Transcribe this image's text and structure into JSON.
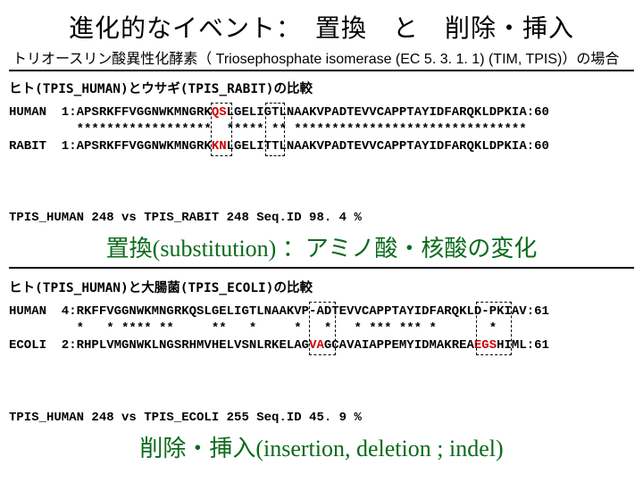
{
  "title": "進化的なイベント：　置換　と　削除・挿入",
  "subtitle": "トリオースリン酸異性化酵素（ Triosephosphate isomerase (EC  5. 3. 1. 1)  (TIM, TPIS)）の場合",
  "section1": {
    "label": "ヒト(TPIS_HUMAN)とウサギ(TPIS_RABIT)の比較",
    "human_a": "HUMAN  1:APSRKFFVGGNWKMNGRK",
    "human_r": "QS",
    "human_b": "LGELI",
    "human_c": "GT",
    "human_d": "LNAAKVPADTEVVCAPPTAYIDFARQKLDPKIA:60",
    "stars": "         ******************  ***** ** *******************************",
    "rabit_a": "RABIT  1:APSRKFFVGGNWKMNGRK",
    "rabit_r": "KN",
    "rabit_b": "LGELI",
    "rabit_c": "TT",
    "rabit_d": "LNAAKVPADTEVVCAPPTAYIDFARQKLDPKIA:60",
    "summary": "TPIS_HUMAN 248 vs TPIS_RABIT 248 Seq.ID 98. 4 %",
    "concept": "置換(substitution) ：アミノ酸・核酸の変化"
  },
  "section2": {
    "label": "ヒト(TPIS_HUMAN)と大腸菌(TPIS_ECOLI)の比較",
    "human": "HUMAN  4:RKFFVGGNWKMNGRKQSLGELIGTLNAAKVP-ADTEVVCAPPTAYIDFARQKLD-PKIAV:61",
    "stars": "         *   * **** **     **   *     *   *   * *** *** *       *",
    "ecoli_a": "ECOLI  2:RHPLVMGNWKLNGSRHMVHELVSNLRKELAG",
    "ecoli_r1": "VA",
    "ecoli_b": "GCAVAIAPPEMYIDMAKREA",
    "ecoli_r2": "EGS",
    "ecoli_c": "HIML:61",
    "summary": "TPIS_HUMAN 248 vs TPIS_ECOLI 255 Seq.ID 45. 9   %",
    "concept": "削除・挿入(insertion, deletion ; indel)"
  }
}
